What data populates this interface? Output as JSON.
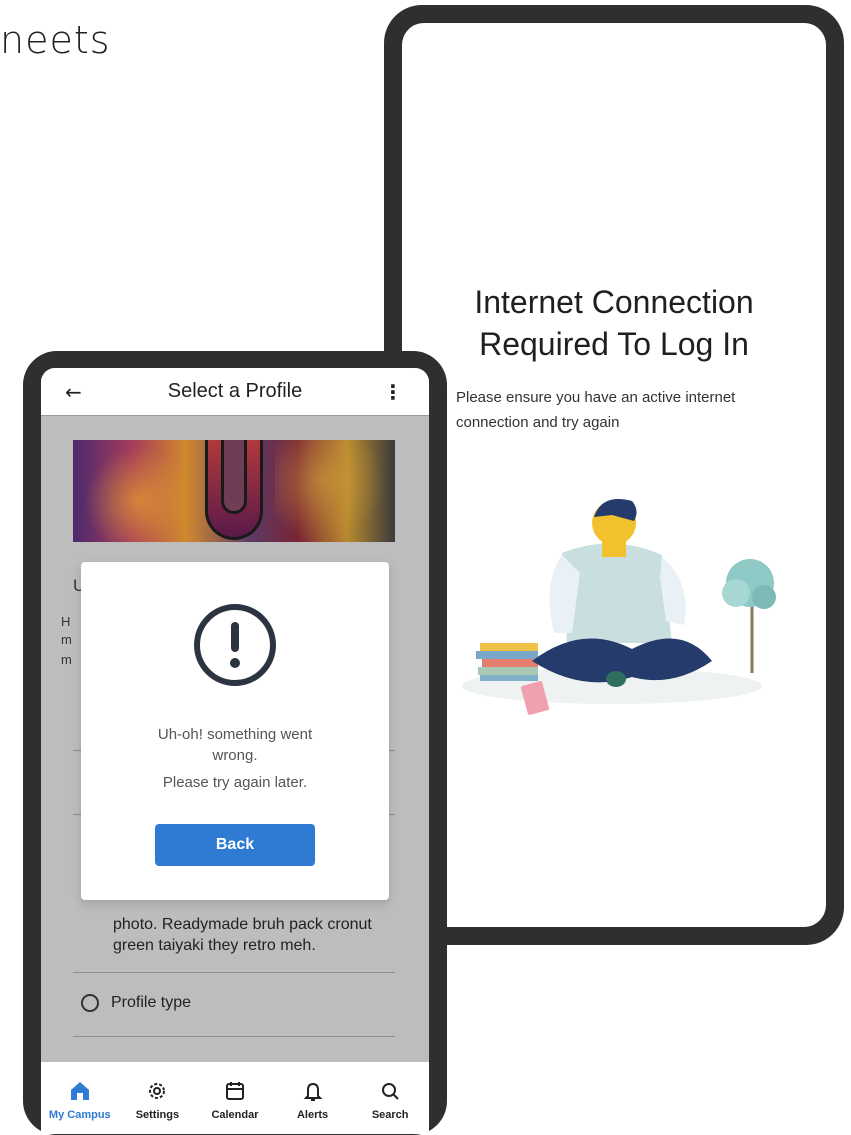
{
  "background": {
    "heading_fragment": "neets"
  },
  "right_phone": {
    "title": "Internet Connection Required To Log In",
    "body": "Please ensure you have an active internet connection and try again"
  },
  "left_phone": {
    "appbar": {
      "back_icon": "←",
      "title": "Select a Profile",
      "more_icon": "⋮"
    },
    "background_fragments": {
      "u": "U",
      "h": "H",
      "m1": "m",
      "m2": "m"
    },
    "background_paragraph": "photo. Readymade bruh pack cronut green taiyaki they retro meh.",
    "radio_option": "Profile type",
    "dialog": {
      "message": "Uh-oh! something went wrong.",
      "message2": "Please try again later.",
      "button": "Back"
    },
    "nav": [
      {
        "label": "My Campus",
        "icon": "home-icon",
        "active": true
      },
      {
        "label": "Settings",
        "icon": "gear-icon",
        "active": false
      },
      {
        "label": "Calendar",
        "icon": "calendar-icon",
        "active": false
      },
      {
        "label": "Alerts",
        "icon": "bell-icon",
        "active": false
      },
      {
        "label": "Search",
        "icon": "search-icon",
        "active": false
      }
    ]
  },
  "colors": {
    "accent": "#2f7bd3",
    "frame": "#2f2f2f",
    "overlay": "#bdbdbd"
  }
}
